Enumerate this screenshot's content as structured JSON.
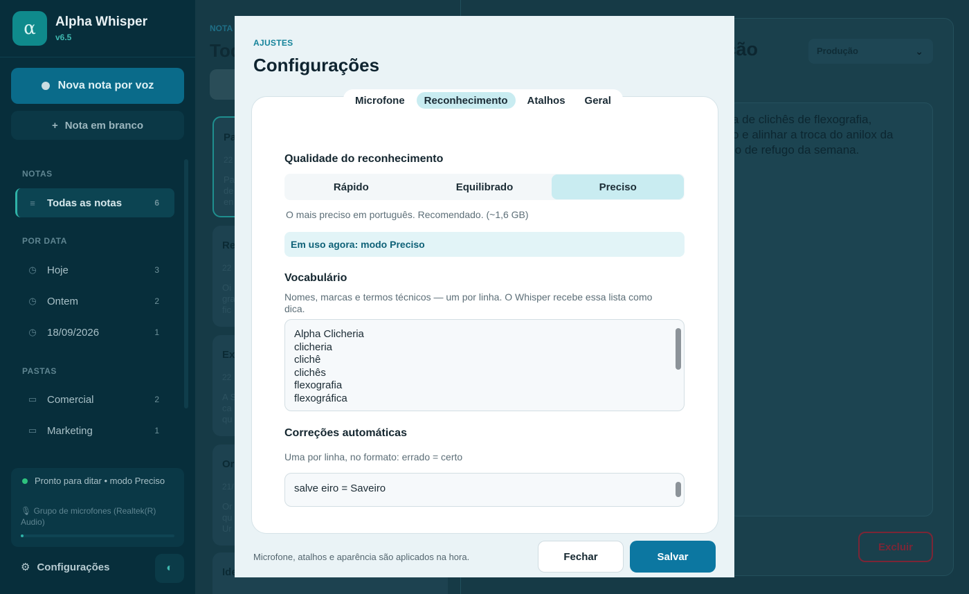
{
  "sidebar": {
    "app_name": "Alpha Whisper",
    "version": "v6.5",
    "logo_glyph": "α",
    "new_voice_label": "Nova nota por voz",
    "new_blank_label": "Nota em branco",
    "sections": {
      "notes_title": "NOTAS",
      "by_date_title": "POR DATA",
      "folders_title": "PASTAS"
    },
    "all_notes": {
      "label": "Todas as notas",
      "count": "6"
    },
    "dates": [
      {
        "label": "Hoje",
        "count": "3"
      },
      {
        "label": "Ontem",
        "count": "2"
      },
      {
        "label": "18/09/2026",
        "count": "1"
      }
    ],
    "folders": [
      {
        "label": "Comercial",
        "count": "2"
      },
      {
        "label": "Marketing",
        "count": "1"
      }
    ],
    "status": {
      "text": "Pronto para ditar  •  modo Preciso",
      "mic": "Grupo de microfones (Realtek(R) Audio)",
      "level_fraction": 0.02
    },
    "settings_label": "Configurações"
  },
  "notes": {
    "kicker": "NOTA",
    "title": "Tod",
    "cards": [
      {
        "title": "Pa",
        "date": "22",
        "preview": [
          "Pa",
          "de",
          "en"
        ]
      },
      {
        "title": "Re",
        "date": "22",
        "preview": [
          "Oi",
          "gra",
          "fic"
        ]
      },
      {
        "title": "Ex",
        "date": "22",
        "preview": [
          "A S",
          "ca",
          "qu"
        ]
      },
      {
        "title": "Or",
        "date": "21/",
        "preview": [
          "Or",
          "qu",
          "Ur"
        ]
      },
      {
        "title": "Ide",
        "date": "",
        "preview": []
      }
    ]
  },
  "editor": {
    "title_fragment": "ução",
    "folder_value": "Produção",
    "text_lines": [
      "a de clichês de flexografia,",
      "o e alinhar a troca do anilox da",
      "io de refugo da semana."
    ],
    "delete_label": "Excluir"
  },
  "modal": {
    "kicker": "AJUSTES",
    "title": "Configurações",
    "tabs": [
      "Microfone",
      "Reconhecimento",
      "Atalhos",
      "Geral"
    ],
    "active_tab": "Reconhecimento",
    "quality": {
      "label": "Qualidade do reconhecimento",
      "options": [
        "Rápido",
        "Equilibrado",
        "Preciso"
      ],
      "selected": "Preciso",
      "hint": "O mais preciso em português. Recomendado. (~1,6 GB)",
      "in_use": "Em uso agora: modo Preciso"
    },
    "vocabulary": {
      "label": "Vocabulário",
      "description": "Nomes, marcas e termos técnicos — um por linha. O Whisper recebe essa lista como dica.",
      "lines": [
        "Alpha Clicheria",
        "clicheria",
        "clichê",
        "clichês",
        "flexografia",
        "flexográfica"
      ]
    },
    "corrections": {
      "label": "Correções automáticas",
      "hint": "Uma por linha, no formato:  errado = certo",
      "lines": [
        "salve eiro = Saveiro"
      ]
    },
    "footer_note": "Microfone, atalhos e aparência são aplicados na hora.",
    "close_label": "Fechar",
    "save_label": "Salvar"
  },
  "colors": {
    "accent": "#0c77a1",
    "teal": "#2fb3a8",
    "danger": "#7b2636",
    "status_ok": "#2ec27e"
  }
}
